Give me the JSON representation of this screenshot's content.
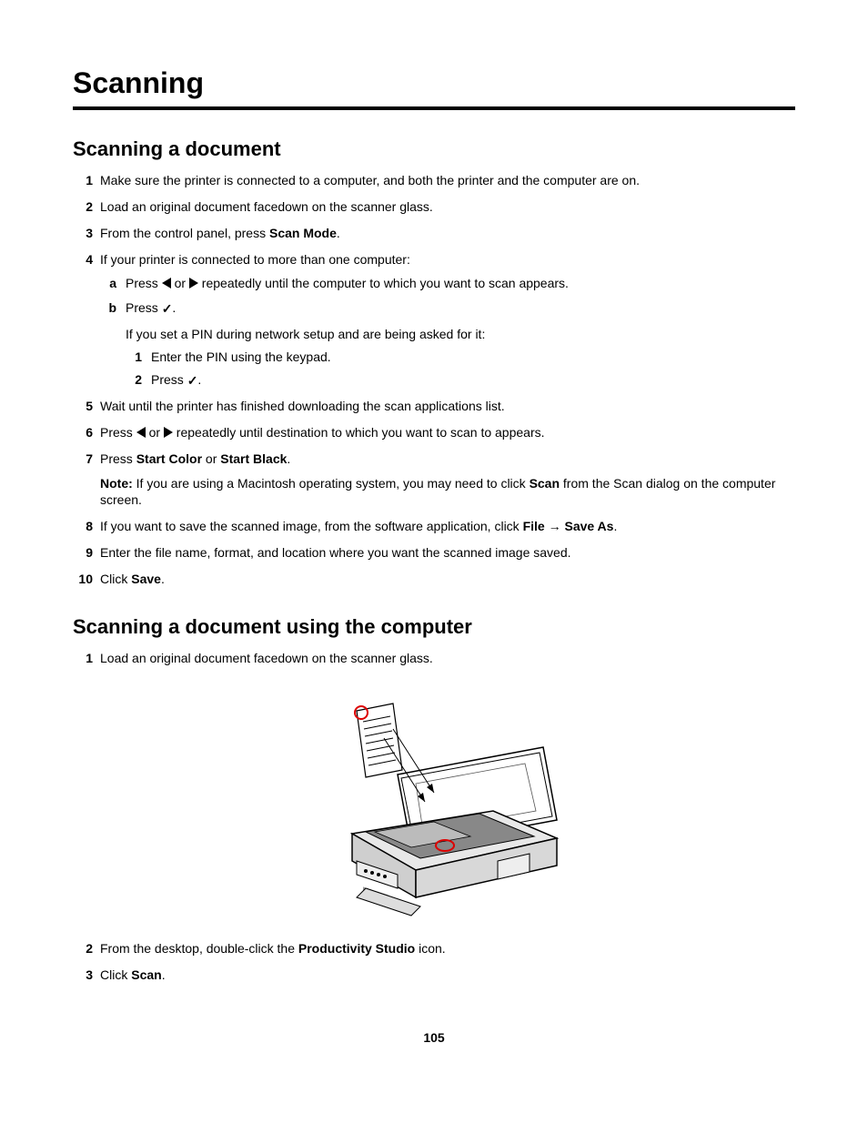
{
  "title": "Scanning",
  "section1": {
    "heading": "Scanning a document",
    "step1": "Make sure the printer is connected to a computer, and both the printer and the computer are on.",
    "step2": "Load an original document facedown on the scanner glass.",
    "step3_a": "From the control panel, press ",
    "step3_b": "Scan Mode",
    "step3_c": ".",
    "step4": "If your printer is connected to more than one computer:",
    "step4a_a": "Press ",
    "step4a_b": " or ",
    "step4a_c": " repeatedly until the computer to which you want to scan appears.",
    "step4b_a": "Press ",
    "step4b_b": ".",
    "pin_intro": "If you set a PIN during network setup and are being asked for it:",
    "pin1": "Enter the PIN using the keypad.",
    "pin2_a": "Press ",
    "pin2_b": ".",
    "step5": "Wait until the printer has finished downloading the scan applications list.",
    "step6_a": "Press ",
    "step6_b": " or ",
    "step6_c": " repeatedly until destination to which you want to scan to appears.",
    "step7_a": "Press ",
    "step7_b": "Start Color",
    "step7_c": " or ",
    "step7_d": "Start Black",
    "step7_e": ".",
    "note_label": "Note:",
    "note_a": " If you are using a Macintosh operating system, you may need to click ",
    "note_b": "Scan",
    "note_c": " from the Scan dialog on the computer screen.",
    "step8_a": "If you want to save the scanned image, from the software application, click ",
    "step8_b": "File",
    "step8_c": " ",
    "step8_d": "Save As",
    "step8_e": ".",
    "step9": "Enter the file name, format, and location where you want the scanned image saved.",
    "step10_a": "Click ",
    "step10_b": "Save",
    "step10_c": "."
  },
  "section2": {
    "heading": "Scanning a document using the computer",
    "step1": "Load an original document facedown on the scanner glass.",
    "step2_a": "From the desktop, double-click the ",
    "step2_b": "Productivity Studio",
    "step2_c": " icon.",
    "step3_a": "Click ",
    "step3_b": "Scan",
    "step3_c": "."
  },
  "page_number": "105"
}
